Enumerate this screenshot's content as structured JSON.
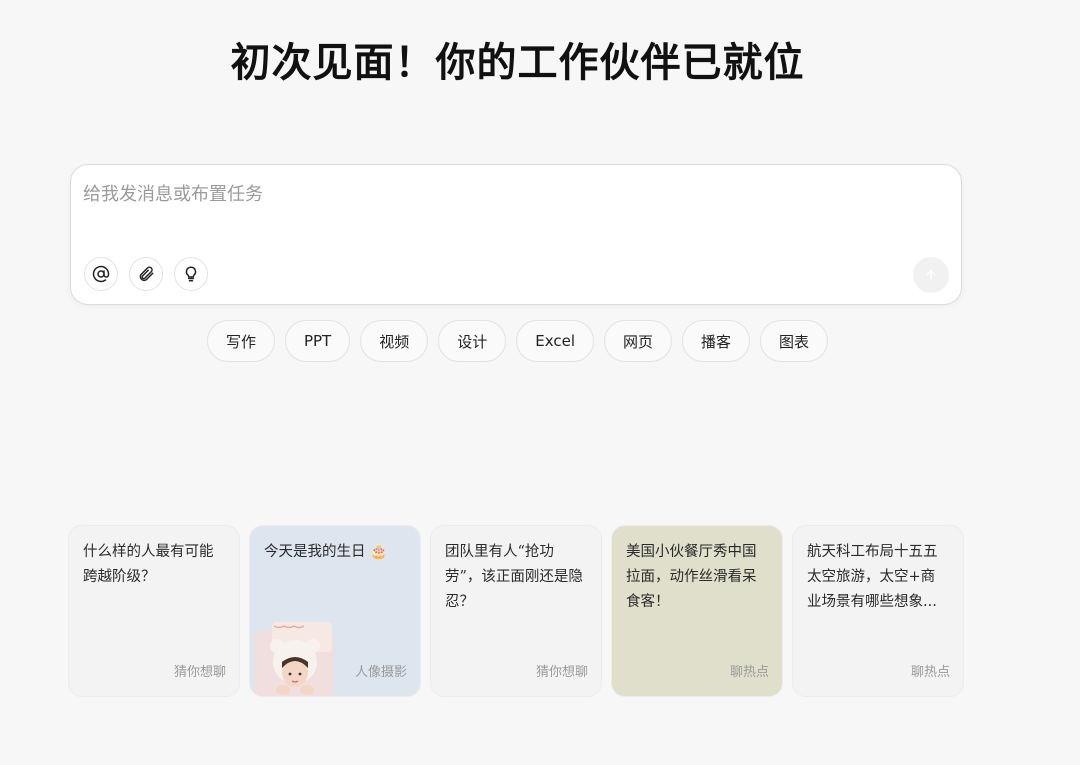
{
  "hero": {
    "title": "初次见面！你的工作伙伴已就位"
  },
  "composer": {
    "placeholder": "给我发消息或布置任务",
    "value": "",
    "tools": [
      {
        "icon": "at-icon"
      },
      {
        "icon": "paperclip-icon"
      },
      {
        "icon": "lightbulb-icon"
      }
    ],
    "send_icon": "arrow-up-icon"
  },
  "chips": [
    {
      "label": "写作"
    },
    {
      "label": "PPT"
    },
    {
      "label": "视频"
    },
    {
      "label": "设计"
    },
    {
      "label": "Excel"
    },
    {
      "label": "网页"
    },
    {
      "label": "播客"
    },
    {
      "label": "图表"
    }
  ],
  "cards": [
    {
      "text": "什么样的人最有可能跨越阶级？",
      "tag": "猜你想聊",
      "bg": "#f3f3f3"
    },
    {
      "text": "今天是我的生日",
      "emoji": "🎂",
      "tag": "人像摄影",
      "bg": "#dde6ee"
    },
    {
      "text": "团队里有人“抢功劳”，该正面刚还是隐忍？",
      "tag": "猜你想聊",
      "bg": "#f3f3f3"
    },
    {
      "text": "美国小伙餐厅秀中国拉面，动作丝滑看呆食客！",
      "tag": "聊热点",
      "bg": "#dfdfcb"
    },
    {
      "text": "航天科工布局十五五太空旅游，太空+商业场景有哪些想象...",
      "tag": "聊热点",
      "bg": "#f3f3f3"
    }
  ]
}
